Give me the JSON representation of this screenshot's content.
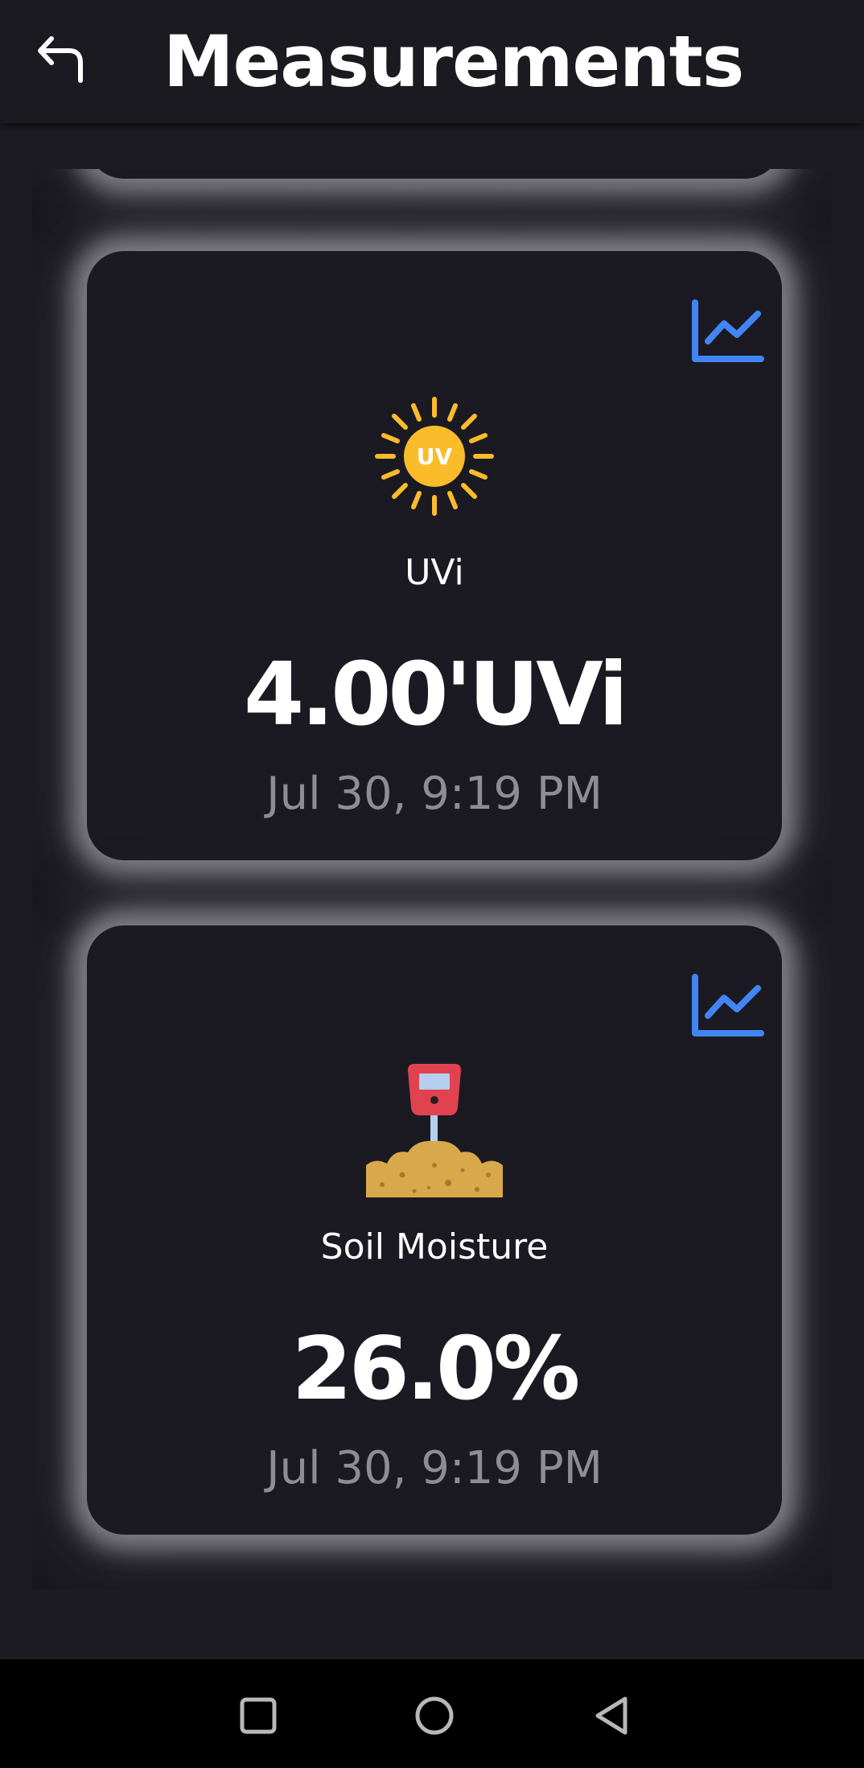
{
  "header": {
    "title": "Measurements",
    "back_icon": "back-arrow-icon"
  },
  "colors": {
    "background": "#1d1c23",
    "card": "#1b1a22",
    "accent_blue": "#4285f4",
    "uv_yellow": "#fbbc2c",
    "soil_sand": "#d8a94a",
    "meter_red": "#e0434f",
    "meter_screen": "#b5cff0",
    "time_gray": "#8e8d93"
  },
  "cards": [
    {
      "icon": "uv-sun-icon",
      "icon_text": "UV",
      "label": "UVi",
      "value": "4.00'UVi",
      "timestamp": "Jul 30, 9:19 PM",
      "chart_icon": "line-chart-icon"
    },
    {
      "icon": "soil-moisture-meter-icon",
      "label": "Soil Moisture",
      "value": "26.0%",
      "timestamp": "Jul 30, 9:19 PM",
      "chart_icon": "line-chart-icon"
    }
  ],
  "nav": {
    "recents_icon": "square-icon",
    "home_icon": "circle-icon",
    "back_icon": "triangle-back-icon"
  }
}
